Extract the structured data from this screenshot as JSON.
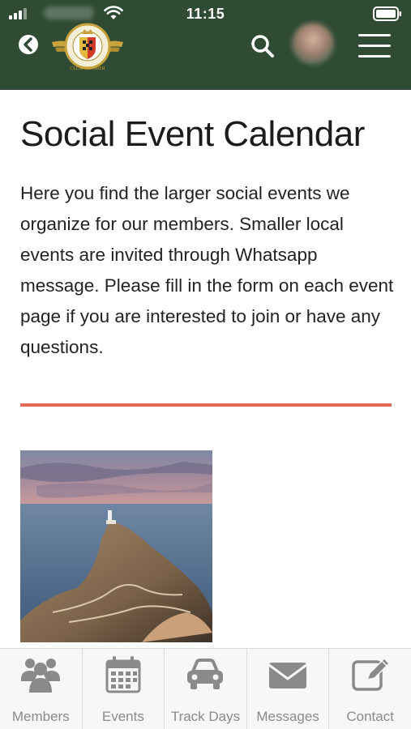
{
  "status_bar": {
    "time": "11:15"
  },
  "header": {
    "logo_text": "GENTLEMEN DRIVING CLUB MEMBER",
    "icons": [
      "back-icon",
      "search-icon",
      "avatar",
      "hamburger-menu-icon"
    ]
  },
  "page": {
    "title": "Social Event Calendar",
    "intro": "Here you find the larger social events we organize for our members. Smaller local events are invited through Whatsapp message.  Please fill in the form on each event page if you are interested to join or have any questions.",
    "accent_color": "#e56b58"
  },
  "colors": {
    "header_bg": "#2f4b34",
    "nav_icon": "#8a8a8a"
  },
  "bottom_nav": {
    "items": [
      {
        "label": "Members",
        "icon": "members-icon"
      },
      {
        "label": "Events",
        "icon": "calendar-icon"
      },
      {
        "label": "Track Days",
        "icon": "car-icon"
      },
      {
        "label": "Messages",
        "icon": "envelope-icon"
      },
      {
        "label": "Contact",
        "icon": "edit-icon"
      }
    ]
  }
}
